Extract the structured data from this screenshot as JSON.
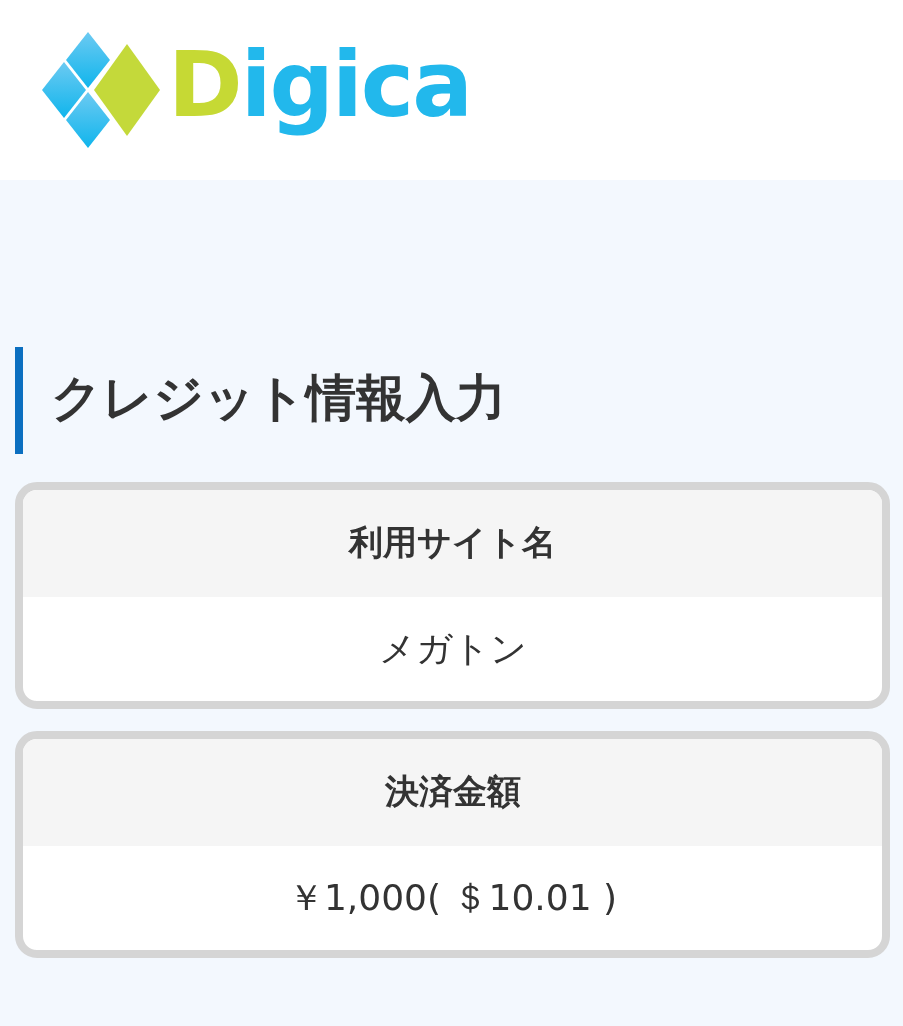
{
  "logo": {
    "text": "Digica"
  },
  "heading": "クレジット情報入力",
  "cards": [
    {
      "label": "利用サイト名",
      "value": "メガトン"
    },
    {
      "label": "決済金額",
      "value": "￥1,000( ＄10.01 )"
    }
  ]
}
